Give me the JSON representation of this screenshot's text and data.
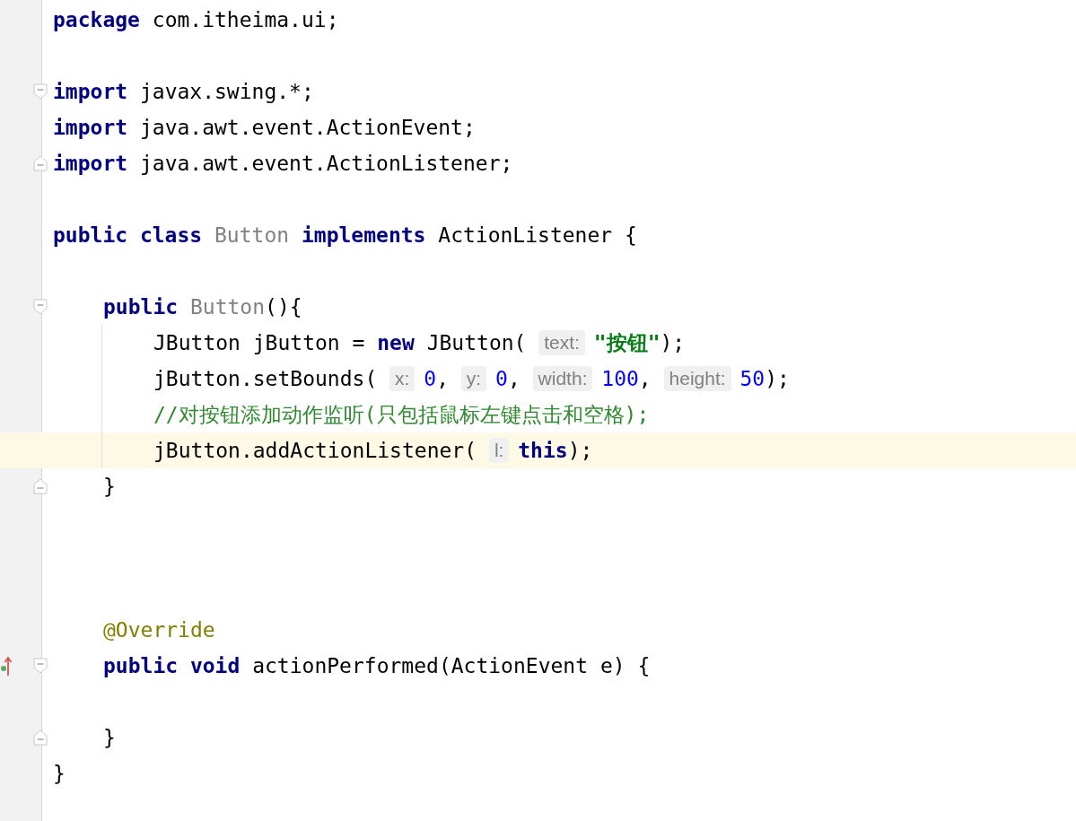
{
  "editor": {
    "lines": [
      {
        "kind": "code",
        "tokens": [
          {
            "kind": "keyword",
            "text": "package"
          },
          {
            "kind": "plain",
            "text": " com.itheima.ui;"
          }
        ]
      },
      {
        "kind": "blank"
      },
      {
        "kind": "code",
        "fold_start": true,
        "tokens": [
          {
            "kind": "keyword",
            "text": "import"
          },
          {
            "kind": "plain",
            "text": " javax.swing.*;"
          }
        ]
      },
      {
        "kind": "code",
        "tokens": [
          {
            "kind": "keyword",
            "text": "import"
          },
          {
            "kind": "plain",
            "text": " java.awt.event.ActionEvent;"
          }
        ]
      },
      {
        "kind": "code",
        "fold_end": true,
        "tokens": [
          {
            "kind": "keyword",
            "text": "import"
          },
          {
            "kind": "plain",
            "text": " java.awt.event.ActionListener;"
          }
        ]
      },
      {
        "kind": "blank"
      },
      {
        "kind": "code",
        "tokens": [
          {
            "kind": "keyword",
            "text": "public class"
          },
          {
            "kind": "unused",
            "text": " Button"
          },
          {
            "kind": "keyword",
            "text": " implements"
          },
          {
            "kind": "plain",
            "text": " ActionListener {"
          }
        ],
        "children": [
          {
            "kind": "blank"
          },
          {
            "kind": "code",
            "fold_start": true,
            "indent_guide": true,
            "tokens": [
              {
                "kind": "keyword",
                "text": "public"
              },
              {
                "kind": "unused",
                "text": " Button"
              },
              {
                "kind": "plain",
                "text": "(){"
              }
            ],
            "children": [
              {
                "kind": "code",
                "tokens": [
                  {
                    "kind": "plain",
                    "text": "JButton jButton = "
                  },
                  {
                    "kind": "keyword",
                    "text": "new"
                  },
                  {
                    "kind": "plain",
                    "text": " JButton( "
                  },
                  {
                    "kind": "hint",
                    "text": "text:"
                  },
                  {
                    "kind": "string",
                    "text": " \"按钮\""
                  },
                  {
                    "kind": "plain",
                    "text": ");"
                  }
                ]
              },
              {
                "kind": "code",
                "tokens": [
                  {
                    "kind": "plain",
                    "text": "jButton.setBounds( "
                  },
                  {
                    "kind": "hint",
                    "text": "x:"
                  },
                  {
                    "kind": "number",
                    "text": " 0"
                  },
                  {
                    "kind": "plain",
                    "text": ", "
                  },
                  {
                    "kind": "hint",
                    "text": "y:"
                  },
                  {
                    "kind": "number",
                    "text": " 0"
                  },
                  {
                    "kind": "plain",
                    "text": ", "
                  },
                  {
                    "kind": "hint",
                    "text": "width:"
                  },
                  {
                    "kind": "number",
                    "text": " 100"
                  },
                  {
                    "kind": "plain",
                    "text": ", "
                  },
                  {
                    "kind": "hint",
                    "text": "height:"
                  },
                  {
                    "kind": "number",
                    "text": " 50"
                  },
                  {
                    "kind": "plain",
                    "text": ");"
                  }
                ]
              },
              {
                "kind": "code",
                "tokens": [
                  {
                    "kind": "comment",
                    "text": "//对按钮添加动作监听(只包括鼠标左键点击和空格);"
                  }
                ]
              },
              {
                "kind": "code",
                "highlighted": true,
                "tokens": [
                  {
                    "kind": "plain",
                    "text": "jButton.addActionListener( "
                  },
                  {
                    "kind": "hint",
                    "text": "l:"
                  },
                  {
                    "kind": "keyword",
                    "text": " this"
                  },
                  {
                    "kind": "plain",
                    "text": ");"
                  }
                ]
              }
            ]
          },
          {
            "kind": "code",
            "fold_end": true,
            "tokens": [
              {
                "kind": "plain",
                "text": "}"
              }
            ]
          },
          {
            "kind": "blank"
          },
          {
            "kind": "blank"
          },
          {
            "kind": "blank"
          },
          {
            "kind": "code",
            "tokens": [
              {
                "kind": "annotation",
                "text": "@Override"
              }
            ]
          },
          {
            "kind": "code",
            "fold_start": true,
            "overrides_marker": true,
            "tokens": [
              {
                "kind": "keyword",
                "text": "public void"
              },
              {
                "kind": "plain",
                "text": " actionPerformed(ActionEvent e) {"
              }
            ],
            "children": [
              {
                "kind": "blank"
              }
            ]
          },
          {
            "kind": "code",
            "fold_end": true,
            "tokens": [
              {
                "kind": "plain",
                "text": "}"
              }
            ]
          }
        ]
      },
      {
        "kind": "code",
        "tokens": [
          {
            "kind": "plain",
            "text": "}"
          }
        ]
      }
    ]
  }
}
